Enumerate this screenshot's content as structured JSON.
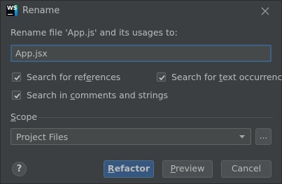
{
  "window": {
    "title": "Rename",
    "app_icon": "webstorm-icon",
    "app_icon_text": "WS"
  },
  "dialog": {
    "prompt": "Rename file 'App.js' and its usages to:",
    "new_name_value": "App.jsx"
  },
  "options": {
    "search_references": {
      "label_pre": "Search for ref",
      "label_mnemonic": "e",
      "label_post": "rences",
      "checked": true
    },
    "search_text": {
      "label_pre": "Search for ",
      "label_mnemonic": "t",
      "label_post": "ext occurrences",
      "checked": true
    },
    "search_comments": {
      "label_pre": "Search in ",
      "label_mnemonic": "c",
      "label_post": "omments and strings",
      "checked": true
    }
  },
  "scope": {
    "label_mnemonic": "S",
    "label_post": "cope",
    "selected": "Project Files",
    "more_label": "..."
  },
  "buttons": {
    "help_label": "?",
    "refactor_mnemonic": "R",
    "refactor_post": "efactor",
    "preview_mnemonic": "P",
    "preview_post": "review",
    "cancel_label": "Cancel"
  },
  "colors": {
    "background": "#3c3f41",
    "input_background": "#45494a",
    "focus_border": "#3d6185",
    "primary_button": "#365880",
    "text": "#bbbbbb"
  }
}
